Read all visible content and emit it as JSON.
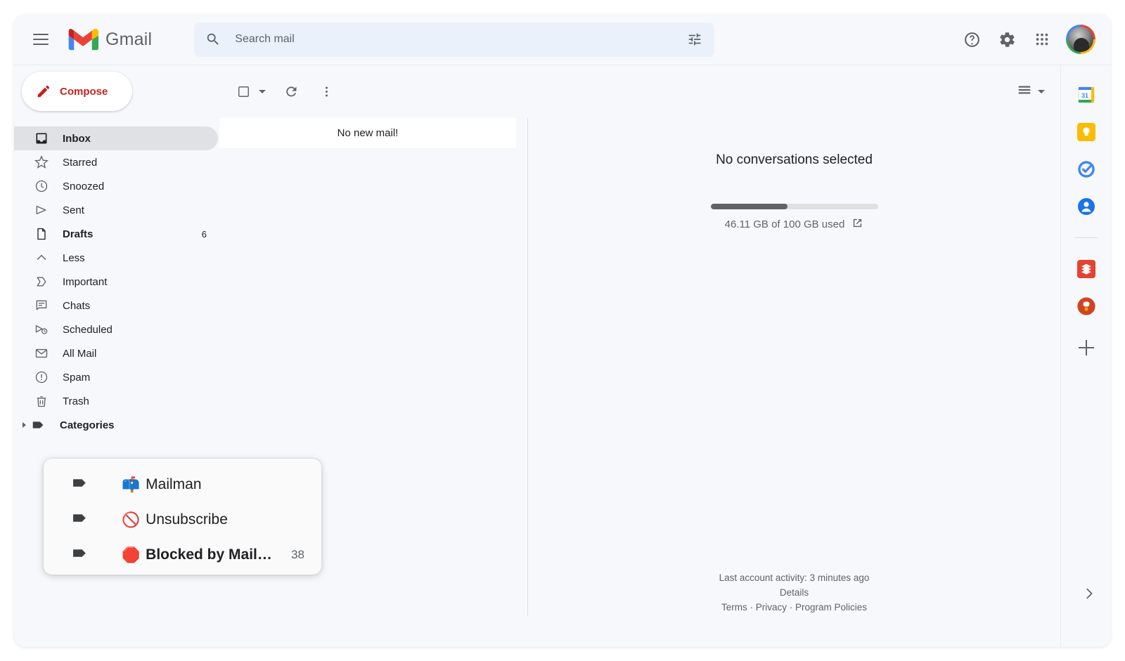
{
  "app": {
    "title": "Gmail",
    "logo_icon": "gmail-logo"
  },
  "topbar": {
    "menu_icon": "hamburger-menu-icon",
    "search": {
      "placeholder": "Search mail",
      "icon": "search-icon",
      "options_icon": "tune-options-icon"
    },
    "help_icon": "help-circle-icon",
    "settings_icon": "gear-icon",
    "apps_icon": "apps-grid-icon",
    "avatar": "user-avatar"
  },
  "sidebar": {
    "compose": {
      "label": "Compose",
      "icon": "pencil-icon"
    },
    "items": [
      {
        "label": "Inbox",
        "icon": "inbox-icon",
        "active": true,
        "bold": true,
        "count": ""
      },
      {
        "label": "Starred",
        "icon": "star-icon",
        "active": false,
        "bold": false,
        "count": ""
      },
      {
        "label": "Snoozed",
        "icon": "clock-icon",
        "active": false,
        "bold": false,
        "count": ""
      },
      {
        "label": "Sent",
        "icon": "send-icon",
        "active": false,
        "bold": false,
        "count": ""
      },
      {
        "label": "Drafts",
        "icon": "draft-file-icon",
        "active": false,
        "bold": true,
        "count": "6"
      },
      {
        "label": "Less",
        "icon": "chevron-up-icon",
        "active": false,
        "bold": false,
        "count": ""
      },
      {
        "label": "Important",
        "icon": "important-label-icon",
        "active": false,
        "bold": false,
        "count": ""
      },
      {
        "label": "Chats",
        "icon": "chat-bubble-icon",
        "active": false,
        "bold": false,
        "count": ""
      },
      {
        "label": "Scheduled",
        "icon": "scheduled-send-icon",
        "active": false,
        "bold": false,
        "count": ""
      },
      {
        "label": "All Mail",
        "icon": "envelope-icon",
        "active": false,
        "bold": false,
        "count": ""
      },
      {
        "label": "Spam",
        "icon": "spam-alert-icon",
        "active": false,
        "bold": false,
        "count": ""
      },
      {
        "label": "Trash",
        "icon": "trash-icon",
        "active": false,
        "bold": false,
        "count": ""
      }
    ],
    "categories": {
      "label": "Categories",
      "icon": "label-tag-icon",
      "expander_icon": "triangle-right-icon"
    }
  },
  "label_popup": {
    "items": [
      {
        "emoji": "📫",
        "label": "Mailman",
        "count": "",
        "bold": false,
        "icon": "label-tag-icon"
      },
      {
        "emoji": "🚫",
        "label": "Unsubscribe",
        "count": "",
        "bold": false,
        "icon": "label-tag-icon"
      },
      {
        "emoji": "🛑",
        "label": "Blocked by Mail…",
        "count": "38",
        "bold": true,
        "icon": "label-tag-icon"
      }
    ]
  },
  "toolbar": {
    "select_checkbox_icon": "select-all-checkbox",
    "select_dropdown_icon": "chevron-down-icon",
    "refresh_icon": "refresh-icon",
    "more_icon": "more-vertical-icon",
    "density_icon": "list-density-icon",
    "density_dropdown_icon": "chevron-down-icon"
  },
  "mail_list": {
    "empty_message": "No new mail!"
  },
  "reading_pane": {
    "title": "No conversations selected",
    "storage": {
      "used_percent": 46.11,
      "text": "46.11 GB of 100 GB used",
      "external_link_icon": "open-in-new-icon"
    }
  },
  "footer": {
    "activity": "Last account activity: 3 minutes ago",
    "details": "Details",
    "links": [
      "Terms",
      "Privacy",
      "Program Policies"
    ],
    "separator": " · "
  },
  "app_rail": {
    "items": [
      {
        "name": "google-calendar-icon",
        "day": "31"
      },
      {
        "name": "google-keep-icon"
      },
      {
        "name": "google-tasks-icon"
      },
      {
        "name": "google-contacts-icon"
      },
      {
        "name": "todoist-icon"
      },
      {
        "name": "red-app-icon"
      }
    ],
    "add_icon": "add-plus-icon",
    "expand_icon": "chevron-right-icon"
  }
}
